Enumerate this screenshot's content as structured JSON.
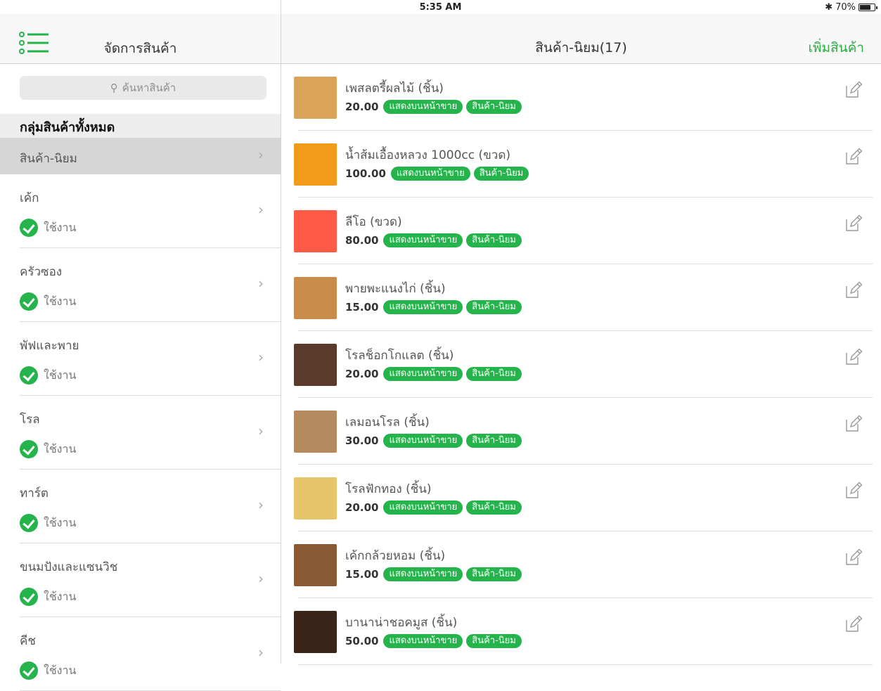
{
  "status_bar": {
    "device": "iPad",
    "time": "5:35 AM",
    "battery": "70%"
  },
  "left": {
    "title": "จัดการสินค้า",
    "search_placeholder": "ค้นหาสินค้า",
    "group_header": "กลุ่มสินค้าทั้งหมด",
    "selected_category": "สินค้า-นิยม",
    "categories": [
      {
        "name": "เค้ก",
        "status": "ใช้งาน"
      },
      {
        "name": "ครัวซอง",
        "status": "ใช้งาน"
      },
      {
        "name": "พัฟและพาย",
        "status": "ใช้งาน"
      },
      {
        "name": "โรล",
        "status": "ใช้งาน"
      },
      {
        "name": "ทาร์ต",
        "status": "ใช้งาน"
      },
      {
        "name": "ขนมปังและแซนวิช",
        "status": "ใช้งาน"
      },
      {
        "name": "คีช",
        "status": "ใช้งาน"
      }
    ]
  },
  "right": {
    "title": "สินค้า-นิยม(17)",
    "add_button": "เพิ่มสินค้า",
    "tag_display": "แสดงบนหน้าขาย",
    "tag_group": "สินค้า-นิยม",
    "products": [
      {
        "name": "เพสลตรี้ผลไม้ (ชิ้น)",
        "price": "20.00",
        "thumb_color": "#d9a45a"
      },
      {
        "name": "น้ำส้มเอื้องหลวง 1000cc (ขวด)",
        "price": "100.00",
        "thumb_color": "#f29a1a"
      },
      {
        "name": "ลีโอ (ขวด)",
        "price": "80.00",
        "thumb_color": "#ff5a45"
      },
      {
        "name": "พายพะแนงไก่ (ชิ้น)",
        "price": "15.00",
        "thumb_color": "#c98b4a"
      },
      {
        "name": "โรลช็อกโกแลต (ชิ้น)",
        "price": "20.00",
        "thumb_color": "#5a3a2a"
      },
      {
        "name": "เลมอนโรล (ชิ้น)",
        "price": "30.00",
        "thumb_color": "#b58a5e"
      },
      {
        "name": "โรลฟักทอง (ชิ้น)",
        "price": "20.00",
        "thumb_color": "#e8c56a"
      },
      {
        "name": "เค้กกล้วยหอม (ชิ้น)",
        "price": "15.00",
        "thumb_color": "#8a5a34"
      },
      {
        "name": "บานาน่าชอคมูส (ชิ้น)",
        "price": "50.00",
        "thumb_color": "#3a2418"
      }
    ]
  }
}
